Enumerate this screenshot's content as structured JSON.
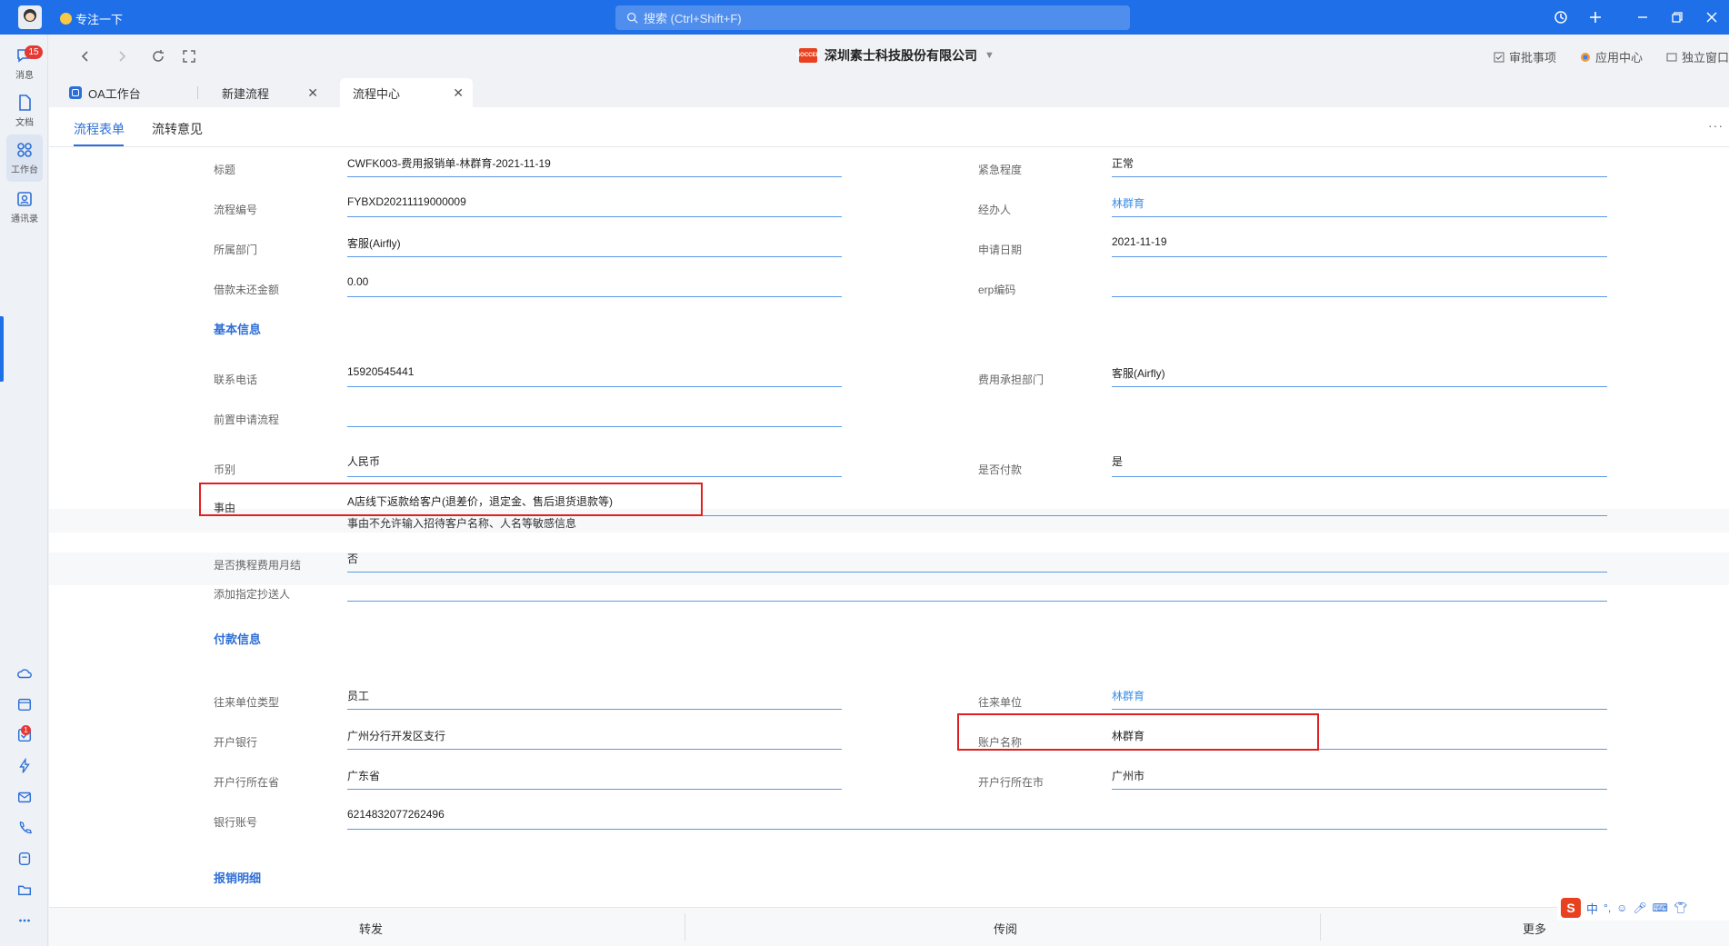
{
  "app": {
    "status_text": "专注一下",
    "search_placeholder": "搜索 (Ctrl+Shift+F)"
  },
  "sidebar": {
    "messages": {
      "label": "消息",
      "badge": "15"
    },
    "docs": {
      "label": "文档"
    },
    "workbench": {
      "label": "工作台"
    },
    "contacts": {
      "label": "通讯录"
    },
    "task_badge": "1"
  },
  "navbar": {
    "company_logo_text": "SOCCER",
    "company": "深圳素士科技股份有限公司",
    "approve": "审批事项",
    "app_center": "应用中心",
    "standalone": "独立窗口"
  },
  "tabs": [
    {
      "label": "OA工作台"
    },
    {
      "label": "新建流程"
    },
    {
      "label": "流程中心"
    }
  ],
  "subtabs": [
    {
      "label": "流程表单"
    },
    {
      "label": "流转意见"
    }
  ],
  "form": {
    "title_label": "标题",
    "title_value": "CWFK003-费用报销单-林群育-2021-11-19",
    "urgency_label": "紧急程度",
    "urgency_value": "正常",
    "flow_no_label": "流程编号",
    "flow_no_value": "FYBXD20211119000009",
    "handler_label": "经办人",
    "handler_value": "林群育",
    "dept_label": "所属部门",
    "dept_value": "客服(Airfly)",
    "apply_date_label": "申请日期",
    "apply_date_value": "2021-11-19",
    "loan_label": "借款未还金额",
    "loan_value": "0.00",
    "erp_label": "erp编码",
    "erp_value": "",
    "section_basic": "基本信息",
    "phone_label": "联系电话",
    "phone_value": "15920545441",
    "cost_dept_label": "费用承担部门",
    "cost_dept_value": "客服(Airfly)",
    "pre_flow_label": "前置申请流程",
    "pre_flow_value": "",
    "currency_label": "币别",
    "currency_value": "人民币",
    "paid_label": "是否付款",
    "paid_value": "是",
    "reason_label": "事由",
    "reason_value": "A店线下返款给客户(退差价，退定金、售后退货退款等)",
    "reason_hint": "事由不允许输入招待客户名称、人名等敏感信息",
    "travel_label": "是否携程费用月结",
    "travel_value": "否",
    "cc_label": "添加指定抄送人",
    "cc_value": "",
    "section_payment": "付款信息",
    "partner_type_label": "往来单位类型",
    "partner_type_value": "员工",
    "partner_label": "往来单位",
    "partner_value": "林群育",
    "bank_label": "开户银行",
    "bank_value": "广州分行开发区支行",
    "account_name_label": "账户名称",
    "account_name_value": "林群育",
    "bank_province_label": "开户行所在省",
    "bank_province_value": "广东省",
    "bank_city_label": "开户行所在市",
    "bank_city_value": "广州市",
    "account_no_label": "银行账号",
    "account_no_value": "6214832077262496",
    "section_detail": "报销明细"
  },
  "bottom": {
    "forward": "转发",
    "circulate": "传阅",
    "more": "更多"
  },
  "ime": {
    "logo": "S",
    "lang": "中"
  }
}
